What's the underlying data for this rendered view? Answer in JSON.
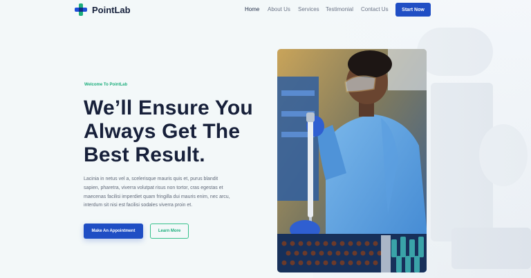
{
  "brand": {
    "name": "PointLab"
  },
  "nav": {
    "items": [
      "Home",
      "About Us",
      "Services",
      "Testimonial",
      "Contact Us"
    ],
    "active": "Home",
    "cta_label": "Start Now"
  },
  "hero": {
    "eyebrow": "Welcome To PointLab",
    "headline_lines": [
      "We’ll Ensure You",
      "Always Get The",
      "Best Result."
    ],
    "description_lines": [
      "Lacinia in netus vel a, scelerisque mauris quis et, purus blandit",
      "sapien, pharetra, viverra volutpat risus non tortor, cras egestas et",
      "maecenas facilisi imperdiet quam fringilla dui mauris enim, nec arcu,",
      "interdum sit nisi est facilisi sodales viverra proin et."
    ],
    "primary_button": "Make An Appointment",
    "secondary_button": "Learn More"
  },
  "colors": {
    "accent_blue": "#1f4ec4",
    "accent_green": "#1cae7c",
    "heading": "#17203a",
    "body_text": "#5f6878"
  },
  "icons": [
    "medical-cross-logo-icon"
  ]
}
